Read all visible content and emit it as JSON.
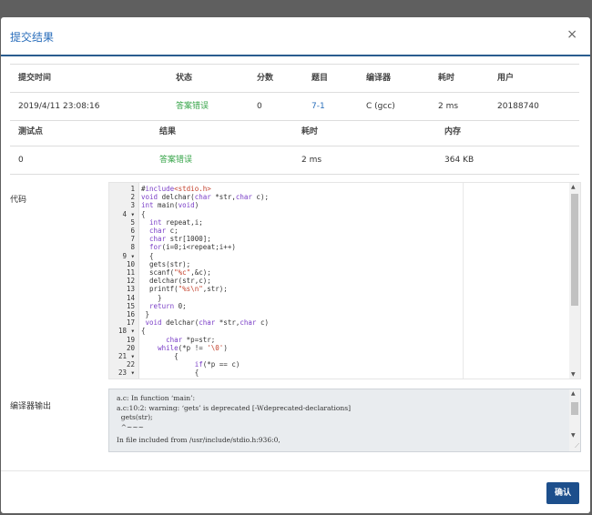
{
  "dialog": {
    "title": "提交结果",
    "close_glyph": "×",
    "confirm_label": "确认"
  },
  "submission": {
    "headers": [
      "提交时间",
      "状态",
      "分数",
      "题目",
      "编译器",
      "耗时",
      "用户"
    ],
    "row": {
      "time": "2019/4/11 23:08:16",
      "status": "答案错误",
      "score": "0",
      "problem": "7-1",
      "compiler": "C (gcc)",
      "elapsed": "2 ms",
      "user": "20188740"
    }
  },
  "testcases": {
    "headers": [
      "测试点",
      "结果",
      "耗时",
      "内存"
    ],
    "row": {
      "id": "0",
      "result": "答案错误",
      "time": "2 ms",
      "memory": "364 KB"
    }
  },
  "code_label": "代码",
  "compiler_output_label": "编译器输出",
  "code_lines": [
    "#include<stdio.h>",
    "void delchar(char *str,char c);",
    "int main(void)",
    "{",
    "  int repeat,i;",
    "  char c;",
    "  char str[1000];",
    "  for(i=0;i<repeat;i++)",
    "  {",
    "  gets(str);",
    "  scanf(\"%c\",&c);",
    "  delchar(str,c);",
    "  printf(\"%s\\n\",str);",
    "    }",
    "  return 0;",
    " }",
    " void delchar(char *str,char c)",
    "{",
    "      char *p=str;",
    "    while(*p != '\\0')",
    "        {",
    "             if(*p == c)",
    "             {"
  ],
  "line_numbers": [
    "1",
    "2",
    "3",
    "4 ▾",
    "5",
    "6",
    "7",
    "8",
    "9 ▾",
    "10",
    "11",
    "12",
    "13",
    "14",
    "15",
    "16",
    "17",
    "18 ▾",
    "19",
    "20",
    "21 ▾",
    "22",
    "23 ▾"
  ],
  "compiler_output": [
    "a.c: In function ‘main’:",
    "a.c:10:2: warning: ‘gets’ is deprecated [-Wdeprecated-declarations]",
    "  gets(str);",
    "  ^~~~",
    "In file included from /usr/include/stdio.h:936:0,"
  ],
  "colors": {
    "accent": "#2a6ebb",
    "success": "#3aa64c",
    "button": "#1d4f8c"
  }
}
